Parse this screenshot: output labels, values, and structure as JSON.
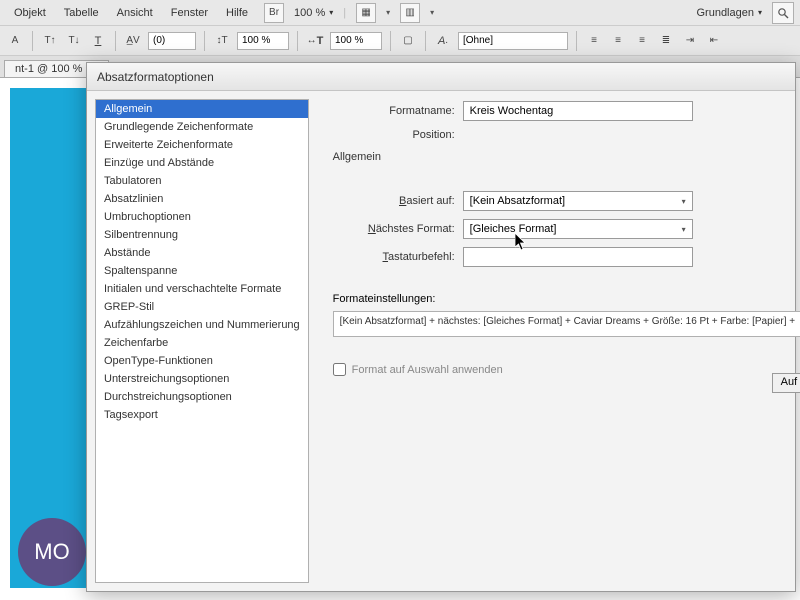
{
  "menubar": {
    "items": [
      "Objekt",
      "Tabelle",
      "Ansicht",
      "Fenster",
      "Hilfe"
    ]
  },
  "topbar": {
    "zoom": "100 %",
    "workspace": "Grundlagen",
    "br": "Br"
  },
  "secondbar": {
    "left_opt_value": "(0)",
    "zoom1": "100 %",
    "zoom2": "100 %",
    "ohne": "[Ohne]"
  },
  "doc_tab": {
    "label": "nt-1 @ 100 %",
    "close": "×"
  },
  "mo_circle": {
    "text": "MO"
  },
  "dialog": {
    "title": "Absatzformatoptionen",
    "sidebar": {
      "items": [
        "Allgemein",
        "Grundlegende Zeichenformate",
        "Erweiterte Zeichenformate",
        "Einzüge und Abstände",
        "Tabulatoren",
        "Absatzlinien",
        "Umbruchoptionen",
        "Silbentrennung",
        "Abstände",
        "Spaltenspanne",
        "Initialen und verschachtelte Formate",
        "GREP-Stil",
        "Aufzählungszeichen und Nummerierung",
        "Zeichenfarbe",
        "OpenType-Funktionen",
        "Unterstreichungsoptionen",
        "Durchstreichungsoptionen",
        "Tagsexport"
      ],
      "selected_index": 0
    },
    "fields": {
      "formatname_label": "Formatname:",
      "formatname_value": "Kreis Wochentag",
      "position_label": "Position:",
      "section": "Allgemein",
      "basiert_label": "Basiert auf:",
      "basiert_value": "[Kein Absatzformat]",
      "naechstes_label": "Nächstes Format:",
      "naechstes_value": "[Gleiches Format]",
      "tastatur_label": "Tastaturbefehl:",
      "tastatur_value": "",
      "settings_label": "Formateinstellungen:",
      "settings_button": "Auf",
      "settings_summary": "[Kein Absatzformat] + nächstes: [Gleiches Format] + Caviar Dreams + Größe: 16 Pt + Farbe: [Papier] +",
      "apply_checkbox": "Format auf Auswahl anwenden"
    }
  }
}
